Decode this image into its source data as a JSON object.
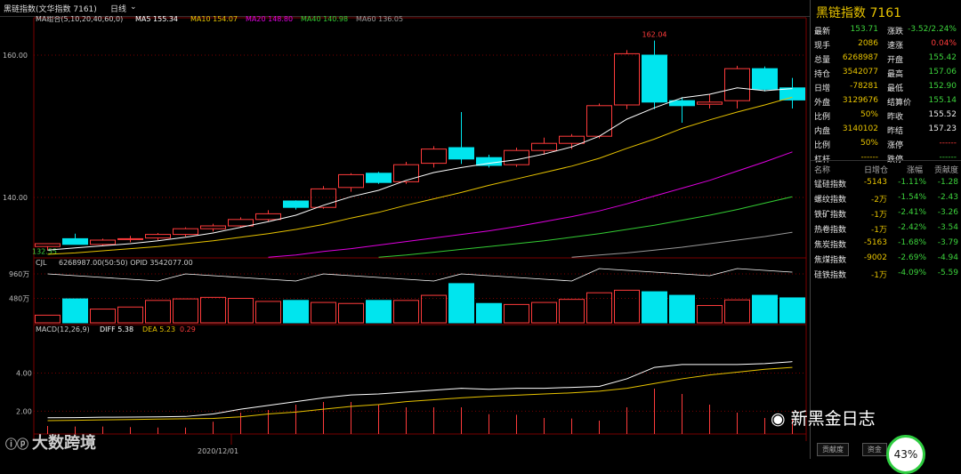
{
  "titlebar": {
    "name": "黑链指数(文华指数 7161)",
    "period": "日线"
  },
  "legends": {
    "ma": {
      "label": "MA组合(5,10,20,40,60,0)",
      "items": [
        {
          "name": "MA5",
          "value": "155.34",
          "color": "#ffffff"
        },
        {
          "name": "MA10",
          "value": "154.07",
          "color": "#e6c200"
        },
        {
          "name": "MA20",
          "value": "148.80",
          "color": "#e000e0"
        },
        {
          "name": "MA40",
          "value": "140.98",
          "color": "#33cc33"
        },
        {
          "name": "MA60",
          "value": "136.05",
          "color": "#999999"
        }
      ]
    },
    "volume": {
      "label": "CJL",
      "text": "6268987.00(50:50) OPID 3542077.00"
    },
    "macd": {
      "label": "MACD(12,26,9)",
      "diff": "DIFF 5.38",
      "dea": "DEA 5.23",
      "macd": "0.29"
    }
  },
  "axes": {
    "price_ticks": [
      "160.00",
      "140.00"
    ],
    "volume_ticks": [
      "960万",
      "480万"
    ],
    "macd_ticks": [
      "4.00",
      "2.00"
    ],
    "date_label": "2020/12/01",
    "high_marker": "162.04",
    "low_marker": "132.55"
  },
  "chart_data": {
    "type": "candlestick",
    "ylim": [
      131.5,
      164
    ],
    "candles": [
      {
        "o": 133.1,
        "h": 133.5,
        "l": 132.55,
        "c": 133.5
      },
      {
        "o": 134.2,
        "h": 134.9,
        "l": 133.4,
        "c": 133.4
      },
      {
        "o": 133.4,
        "h": 134.2,
        "l": 133.2,
        "c": 134.0
      },
      {
        "o": 134.1,
        "h": 134.6,
        "l": 133.7,
        "c": 134.2
      },
      {
        "o": 134.3,
        "h": 135.0,
        "l": 134.0,
        "c": 134.8
      },
      {
        "o": 134.8,
        "h": 135.8,
        "l": 134.5,
        "c": 135.6
      },
      {
        "o": 135.6,
        "h": 136.3,
        "l": 135.2,
        "c": 136.0
      },
      {
        "o": 136.0,
        "h": 137.2,
        "l": 135.8,
        "c": 136.9
      },
      {
        "o": 136.9,
        "h": 138.2,
        "l": 136.6,
        "c": 137.7
      },
      {
        "o": 139.5,
        "h": 139.6,
        "l": 138.3,
        "c": 138.6
      },
      {
        "o": 138.6,
        "h": 141.6,
        "l": 138.4,
        "c": 141.2
      },
      {
        "o": 141.4,
        "h": 143.4,
        "l": 140.8,
        "c": 143.2
      },
      {
        "o": 143.4,
        "h": 143.6,
        "l": 141.9,
        "c": 142.1
      },
      {
        "o": 142.2,
        "h": 145.0,
        "l": 141.9,
        "c": 144.6
      },
      {
        "o": 144.8,
        "h": 147.2,
        "l": 144.2,
        "c": 146.8
      },
      {
        "o": 147.0,
        "h": 152.0,
        "l": 144.7,
        "c": 145.4
      },
      {
        "o": 145.6,
        "h": 146.0,
        "l": 144.2,
        "c": 144.5
      },
      {
        "o": 144.6,
        "h": 147.0,
        "l": 144.3,
        "c": 146.6
      },
      {
        "o": 146.6,
        "h": 148.4,
        "l": 146.0,
        "c": 147.6
      },
      {
        "o": 147.6,
        "h": 148.9,
        "l": 146.8,
        "c": 148.6
      },
      {
        "o": 148.6,
        "h": 153.2,
        "l": 148.3,
        "c": 152.9
      },
      {
        "o": 153.0,
        "h": 160.7,
        "l": 152.4,
        "c": 160.2
      },
      {
        "o": 160.0,
        "h": 162.04,
        "l": 152.4,
        "c": 153.4
      },
      {
        "o": 153.6,
        "h": 154.1,
        "l": 150.5,
        "c": 152.9
      },
      {
        "o": 153.1,
        "h": 154.5,
        "l": 152.5,
        "c": 153.4
      },
      {
        "o": 153.6,
        "h": 158.5,
        "l": 152.5,
        "c": 158.1
      },
      {
        "o": 158.1,
        "h": 158.4,
        "l": 154.9,
        "c": 155.2
      },
      {
        "o": 155.4,
        "h": 156.8,
        "l": 152.5,
        "c": 153.7
      }
    ],
    "ma": {
      "MA5": [
        132.6,
        132.9,
        133.2,
        133.5,
        133.9,
        134.4,
        135.0,
        135.8,
        136.6,
        137.5,
        138.9,
        140.1,
        141.0,
        142.4,
        143.5,
        144.2,
        144.8,
        145.3,
        146.1,
        147.1,
        148.6,
        151.0,
        152.6,
        154.0,
        154.5,
        155.4,
        155.0,
        155.3
      ],
      "MA10": [
        132.0,
        132.2,
        132.5,
        132.8,
        133.1,
        133.5,
        133.9,
        134.4,
        134.9,
        135.5,
        136.2,
        137.1,
        137.9,
        138.9,
        139.8,
        140.7,
        141.7,
        142.6,
        143.5,
        144.4,
        145.5,
        146.9,
        148.2,
        149.7,
        150.9,
        152.0,
        153.0,
        154.1
      ],
      "MA20": [
        null,
        null,
        null,
        null,
        null,
        null,
        null,
        null,
        131.6,
        131.9,
        132.4,
        132.8,
        133.3,
        133.8,
        134.3,
        134.8,
        135.3,
        135.9,
        136.6,
        137.3,
        138.1,
        139.1,
        140.2,
        141.3,
        142.4,
        143.7,
        145.0,
        146.4
      ],
      "MA40": [
        null,
        null,
        null,
        null,
        null,
        null,
        null,
        null,
        null,
        null,
        null,
        null,
        131.6,
        131.9,
        132.3,
        132.7,
        133.1,
        133.5,
        133.9,
        134.4,
        134.9,
        135.5,
        136.1,
        136.8,
        137.5,
        138.3,
        139.2,
        140.1
      ],
      "MA60": [
        null,
        null,
        null,
        null,
        null,
        null,
        null,
        null,
        null,
        null,
        null,
        null,
        null,
        null,
        null,
        null,
        null,
        null,
        null,
        131.6,
        131.9,
        132.2,
        132.6,
        133.0,
        133.5,
        134.0,
        134.5,
        135.1
      ]
    },
    "volume": {
      "ylim": [
        0,
        1100
      ],
      "values": [
        150,
        470,
        270,
        310,
        440,
        470,
        500,
        480,
        420,
        440,
        400,
        380,
        440,
        440,
        540,
        770,
        380,
        360,
        400,
        460,
        590,
        640,
        610,
        540,
        340,
        450,
        540,
        490
      ]
    },
    "macd": {
      "ylim": [
        0.8,
        5.8
      ],
      "diff": [
        1.65,
        1.66,
        1.68,
        1.69,
        1.7,
        1.72,
        1.85,
        2.1,
        2.3,
        2.5,
        2.7,
        2.85,
        2.9,
        3.0,
        3.1,
        3.2,
        3.15,
        3.2,
        3.2,
        3.25,
        3.3,
        3.7,
        4.3,
        4.45,
        4.45,
        4.45,
        4.5,
        4.6
      ],
      "dea": [
        1.5,
        1.52,
        1.54,
        1.56,
        1.58,
        1.6,
        1.62,
        1.7,
        1.85,
        1.95,
        2.1,
        2.25,
        2.35,
        2.5,
        2.6,
        2.7,
        2.78,
        2.84,
        2.9,
        2.96,
        3.05,
        3.2,
        3.45,
        3.7,
        3.9,
        4.05,
        4.2,
        4.3
      ],
      "hist": [
        0.15,
        0.14,
        0.14,
        0.13,
        0.12,
        0.12,
        0.23,
        0.4,
        0.45,
        0.55,
        0.6,
        0.6,
        0.55,
        0.5,
        0.5,
        0.5,
        0.37,
        0.36,
        0.3,
        0.29,
        0.25,
        0.5,
        0.85,
        0.75,
        0.55,
        0.4,
        0.3,
        0.29
      ]
    }
  },
  "panel": {
    "title": "黑链指数 7161",
    "quotes": [
      {
        "l1": "最新",
        "v1": "153.71",
        "c1": "green",
        "l2": "涨跌",
        "v2": "-3.52/2.24%",
        "c2": "green"
      },
      {
        "l1": "现手",
        "v1": "2086",
        "c1": "yellow",
        "l2": "速涨",
        "v2": "0.04%",
        "c2": "red"
      },
      {
        "l1": "总量",
        "v1": "6268987",
        "c1": "yellow",
        "l2": "开盘",
        "v2": "155.42",
        "c2": "green"
      },
      {
        "l1": "持仓",
        "v1": "3542077",
        "c1": "yellow",
        "l2": "最高",
        "v2": "157.06",
        "c2": "green"
      },
      {
        "l1": "日增",
        "v1": "-78281",
        "c1": "yellow",
        "l2": "最低",
        "v2": "152.90",
        "c2": "green"
      },
      {
        "l1": "外盘",
        "v1": "3129676",
        "c1": "yellow",
        "l2": "结算价",
        "v2": "155.14",
        "c2": "green"
      },
      {
        "l1": "比例",
        "v1": "50%",
        "c1": "yellow",
        "l2": "昨收",
        "v2": "155.52",
        "c2": "white"
      },
      {
        "l1": "内盘",
        "v1": "3140102",
        "c1": "yellow",
        "l2": "昨结",
        "v2": "157.23",
        "c2": "white"
      },
      {
        "l1": "比例",
        "v1": "50%",
        "c1": "yellow",
        "l2": "涨停",
        "v2": "------",
        "c2": "red"
      },
      {
        "l1": "杠杆",
        "v1": "------",
        "c1": "yellow",
        "l2": "跌停",
        "v2": "------",
        "c2": "green"
      }
    ],
    "table_headers": [
      "名称",
      "日增仓",
      "涨幅",
      "贡献度"
    ],
    "indices": [
      {
        "name": "锰硅指数",
        "inc": "-5143",
        "chg": "-1.11%",
        "contrib": "-1.28"
      },
      {
        "name": "螺纹指数",
        "inc": "-2万",
        "chg": "-1.54%",
        "contrib": "-2.43"
      },
      {
        "name": "铁矿指数",
        "inc": "-1万",
        "chg": "-2.41%",
        "contrib": "-3.26"
      },
      {
        "name": "热卷指数",
        "inc": "-1万",
        "chg": "-2.42%",
        "contrib": "-3.54"
      },
      {
        "name": "焦炭指数",
        "inc": "-5163",
        "chg": "-1.68%",
        "contrib": "-3.79"
      },
      {
        "name": "焦煤指数",
        "inc": "-9002",
        "chg": "-2.69%",
        "contrib": "-4.94"
      },
      {
        "name": "硅铁指数",
        "inc": "-1万",
        "chg": "-4.09%",
        "contrib": "-5.59"
      }
    ]
  },
  "bottom": {
    "tab1": "贡献度",
    "tab2": "资金",
    "progress": "43%"
  },
  "watermarks": {
    "left": "大数跨境",
    "right": "新黑金日志"
  },
  "colors": {
    "up": "#ff3b3b",
    "down": "#00e5ee",
    "grid": "#7a0000"
  }
}
